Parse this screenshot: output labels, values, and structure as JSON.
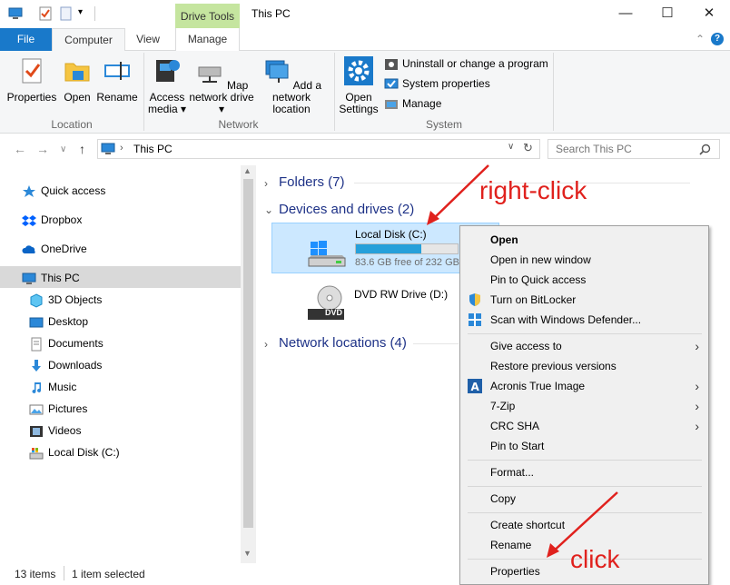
{
  "window": {
    "title": "This PC",
    "context_tab_group": "Drive Tools",
    "minimize": "—",
    "maximize": "☐",
    "close": "✕"
  },
  "tabs": {
    "file": "File",
    "computer": "Computer",
    "view": "View",
    "manage": "Manage"
  },
  "ribbon": {
    "properties": "Properties",
    "open": "Open",
    "rename": "Rename",
    "access_media": "Access media ▾",
    "map_network_drive": "Map network drive ▾",
    "add_network_location": "Add a network location",
    "open_settings": "Open Settings",
    "uninstall": "Uninstall or change a program",
    "system_properties": "System properties",
    "manage": "Manage",
    "group_location": "Location",
    "group_network": "Network",
    "group_system": "System"
  },
  "address": {
    "path": "This PC",
    "search_placeholder": "Search This PC"
  },
  "nav": {
    "quick_access": "Quick access",
    "dropbox": "Dropbox",
    "onedrive": "OneDrive",
    "this_pc": "This PC",
    "objects3d": "3D Objects",
    "desktop": "Desktop",
    "documents": "Documents",
    "downloads": "Downloads",
    "music": "Music",
    "pictures": "Pictures",
    "videos": "Videos",
    "local_disk": "Local Disk (C:)"
  },
  "content": {
    "folders": "Folders (7)",
    "devices": "Devices and drives (2)",
    "network": "Network locations (4)",
    "drive_c_name": "Local Disk (C:)",
    "drive_c_free": "83.6 GB free of 232 GB",
    "drive_c_used_fraction": 0.64,
    "dvd_name": "DVD RW Drive (D:)",
    "dvd_label": "DVD"
  },
  "status": {
    "items": "13 items",
    "selected": "1 item selected"
  },
  "context_menu": {
    "open": "Open",
    "open_new_window": "Open in new window",
    "pin_quick_access": "Pin to Quick access",
    "bitlocker": "Turn on BitLocker",
    "defender": "Scan with Windows Defender...",
    "give_access": "Give access to",
    "restore": "Restore previous versions",
    "acronis": "Acronis True Image",
    "sevenzip": "7-Zip",
    "crc": "CRC SHA",
    "pin_start": "Pin to Start",
    "format": "Format...",
    "copy": "Copy",
    "create_shortcut": "Create shortcut",
    "rename": "Rename",
    "properties": "Properties"
  },
  "annotations": {
    "right_click": "right-click",
    "click": "click",
    "color": "#e0211d"
  }
}
